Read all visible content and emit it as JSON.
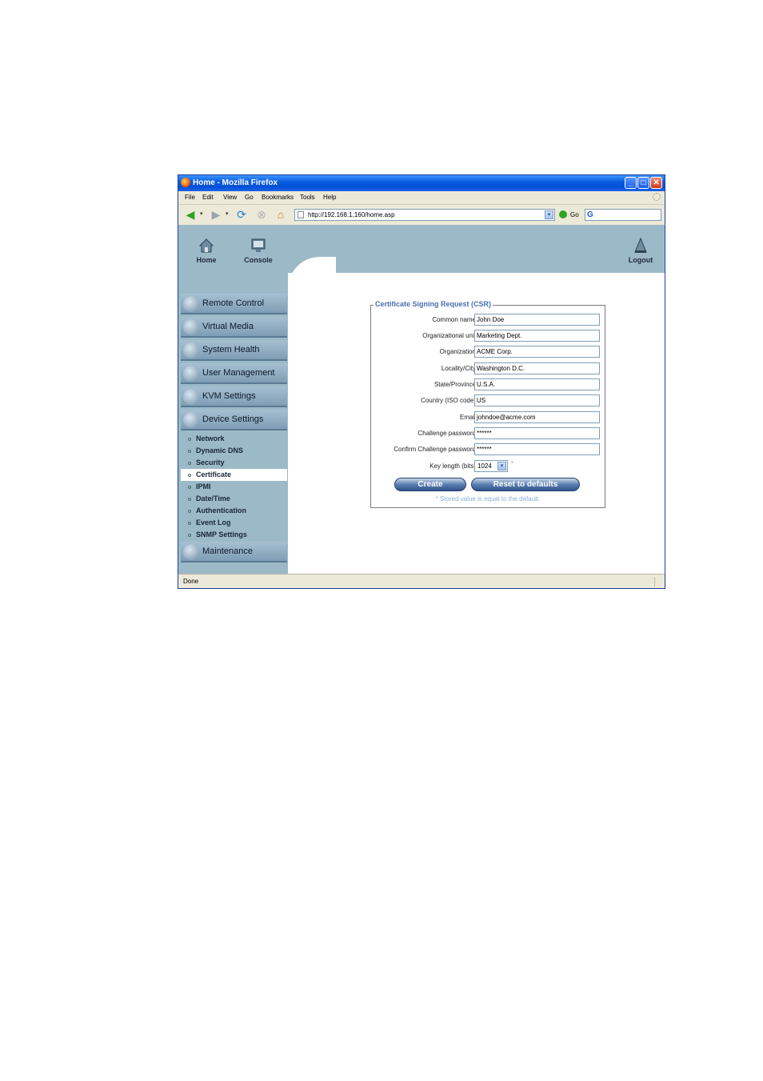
{
  "window": {
    "title": "Home - Mozilla Firefox"
  },
  "menubar": [
    "File",
    "Edit",
    "View",
    "Go",
    "Bookmarks",
    "Tools",
    "Help"
  ],
  "navbar": {
    "url": "http://192.168.1.160/home.asp",
    "go_label": "Go",
    "icons": [
      "back-icon",
      "forward-icon",
      "reload-icon",
      "stop-icon",
      "home-icon"
    ]
  },
  "toolbar": {
    "home_label": "Home",
    "console_label": "Console",
    "logout_label": "Logout"
  },
  "sidebar": {
    "sections": [
      {
        "label": "Remote Control",
        "icon": "magnifier-icon"
      },
      {
        "label": "Virtual Media",
        "icon": "disc-icon"
      },
      {
        "label": "System Health",
        "icon": "health-icon"
      },
      {
        "label": "User Management",
        "icon": "users-icon"
      },
      {
        "label": "KVM Settings",
        "icon": "keyboard-icon"
      },
      {
        "label": "Device Settings",
        "icon": "gears-icon"
      }
    ],
    "device_items": [
      "Network",
      "Dynamic DNS",
      "Security",
      "Certificate",
      "IPMI",
      "Date/Time",
      "Authentication",
      "Event Log",
      "SNMP Settings"
    ],
    "active_item": "Certificate",
    "maintenance": {
      "label": "Maintenance",
      "icon": "tools-icon"
    }
  },
  "form": {
    "legend": "Certificate Signing Request (CSR)",
    "fields": [
      {
        "label": "Common name",
        "value": "John Doe"
      },
      {
        "label": "Organizational unit",
        "value": "Marketing Dept."
      },
      {
        "label": "Organization",
        "value": "ACME Corp."
      },
      {
        "label": "Locality/City",
        "value": "Washington D.C."
      },
      {
        "label": "State/Province",
        "value": "U.S.A."
      },
      {
        "label": "Country (ISO code)",
        "value": "US"
      },
      {
        "label": "Email",
        "value": "johndoe@acme.com"
      },
      {
        "label": "Challenge password",
        "value": "******"
      },
      {
        "label": "Confirm Challenge password",
        "value": "******"
      }
    ],
    "key_length": {
      "label": "Key length (bits)",
      "value": "1024",
      "mark": "*"
    },
    "create_label": "Create",
    "reset_label": "Reset to defaults",
    "note": "* Stored value is equal to the default."
  },
  "status": {
    "text": "Done"
  },
  "colors": {
    "panel": "#9cb9c8",
    "titlebar": "#0a5ee0",
    "legend": "#4a6fb0"
  }
}
